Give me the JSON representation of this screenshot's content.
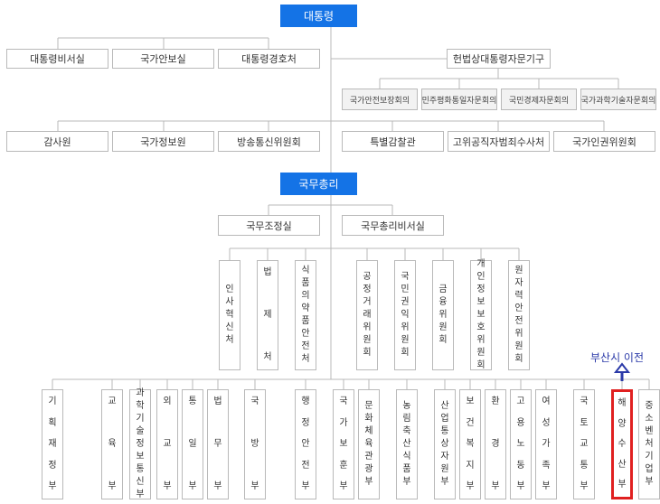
{
  "top": {
    "president": "대통령",
    "prime_minister": "국무총리"
  },
  "president_offices": [
    "대통령비서실",
    "국가안보실",
    "대통령경호처"
  ],
  "advisory_group": {
    "title": "헌법상대통령자문기구",
    "members": [
      "국가안전보장회의",
      "민주평화통일자문회의",
      "국민경제자문회의",
      "국가과학기술자문회의"
    ]
  },
  "independent_left": [
    "감사원",
    "국가정보원",
    "방송통신위원회"
  ],
  "independent_right": [
    "특별감찰관",
    "고위공직자범죄수사처",
    "국가인권위원회"
  ],
  "pm_offices": [
    "국무조정실",
    "국무총리비서실"
  ],
  "pm_agencies": [
    "인사혁신처",
    "법제처",
    "식품의약품안전처"
  ],
  "commissions": [
    "공정거래위원회",
    "국민권익위원회",
    "금융위원회",
    "개인정보보호위원회",
    "원자력안전위원회"
  ],
  "ministries": [
    "기획재정부",
    "교육부",
    "과학기술정보통신부",
    "외교부",
    "통일부",
    "법무부",
    "국방부",
    "행정안전부",
    "국가보훈부",
    "문화체육관광부",
    "농림축산식품부",
    "산업통상자원부",
    "보건복지부",
    "환경부",
    "고용노동부",
    "여성가족부",
    "국토교통부",
    "해양수산부",
    "중소벤처기업부"
  ],
  "highlight": {
    "ministry": "해양수산부",
    "note": "부산시 이전",
    "color": "#e02020",
    "note_color": "#2b3aa8"
  },
  "colors": {
    "primary": "#1473e6",
    "line": "#b9b9b9"
  }
}
